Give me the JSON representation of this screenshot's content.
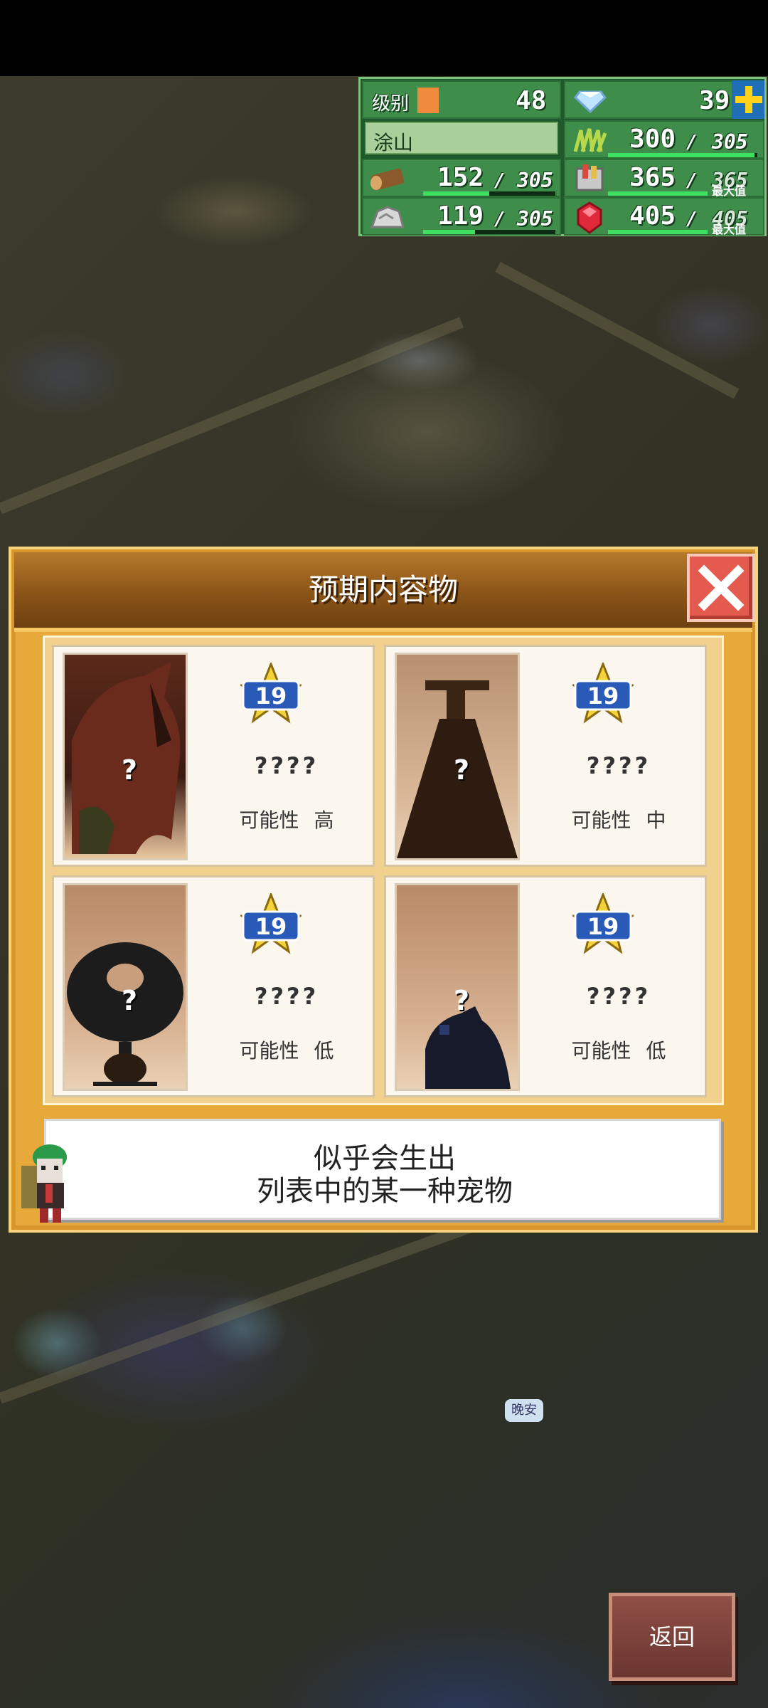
{
  "hud": {
    "level_label": "级别",
    "level_value": "48",
    "gems_value": "39",
    "area_name": "涂山",
    "food_value": "300",
    "food_max": "305",
    "wood_value": "152",
    "wood_max": "305",
    "tools_value": "365",
    "tools_max": "365",
    "tools_max_label": "最大值",
    "ore_value": "119",
    "ore_max": "305",
    "ruby_value": "405",
    "ruby_max": "405",
    "ruby_max_label": "最大值",
    "slash": "/",
    "colors": {
      "panel": "#3f8d4a",
      "bar": "#3fe061",
      "border": "#7ec37c"
    }
  },
  "dialog": {
    "title": "预期内容物",
    "cards": [
      {
        "rank": "19",
        "name": "????",
        "prob_label": "可能性",
        "prob_value": "高",
        "hidden_mark": "?"
      },
      {
        "rank": "19",
        "name": "????",
        "prob_label": "可能性",
        "prob_value": "中",
        "hidden_mark": "?"
      },
      {
        "rank": "19",
        "name": "????",
        "prob_label": "可能性",
        "prob_value": "低",
        "hidden_mark": "?"
      },
      {
        "rank": "19",
        "name": "????",
        "prob_label": "可能性",
        "prob_value": "低",
        "hidden_mark": "?"
      }
    ],
    "message_line1": "似乎会生出",
    "message_line2": "列表中的某一种宠物"
  },
  "world": {
    "speech_bubble": "晚安"
  },
  "back_button": {
    "label": "返回"
  }
}
